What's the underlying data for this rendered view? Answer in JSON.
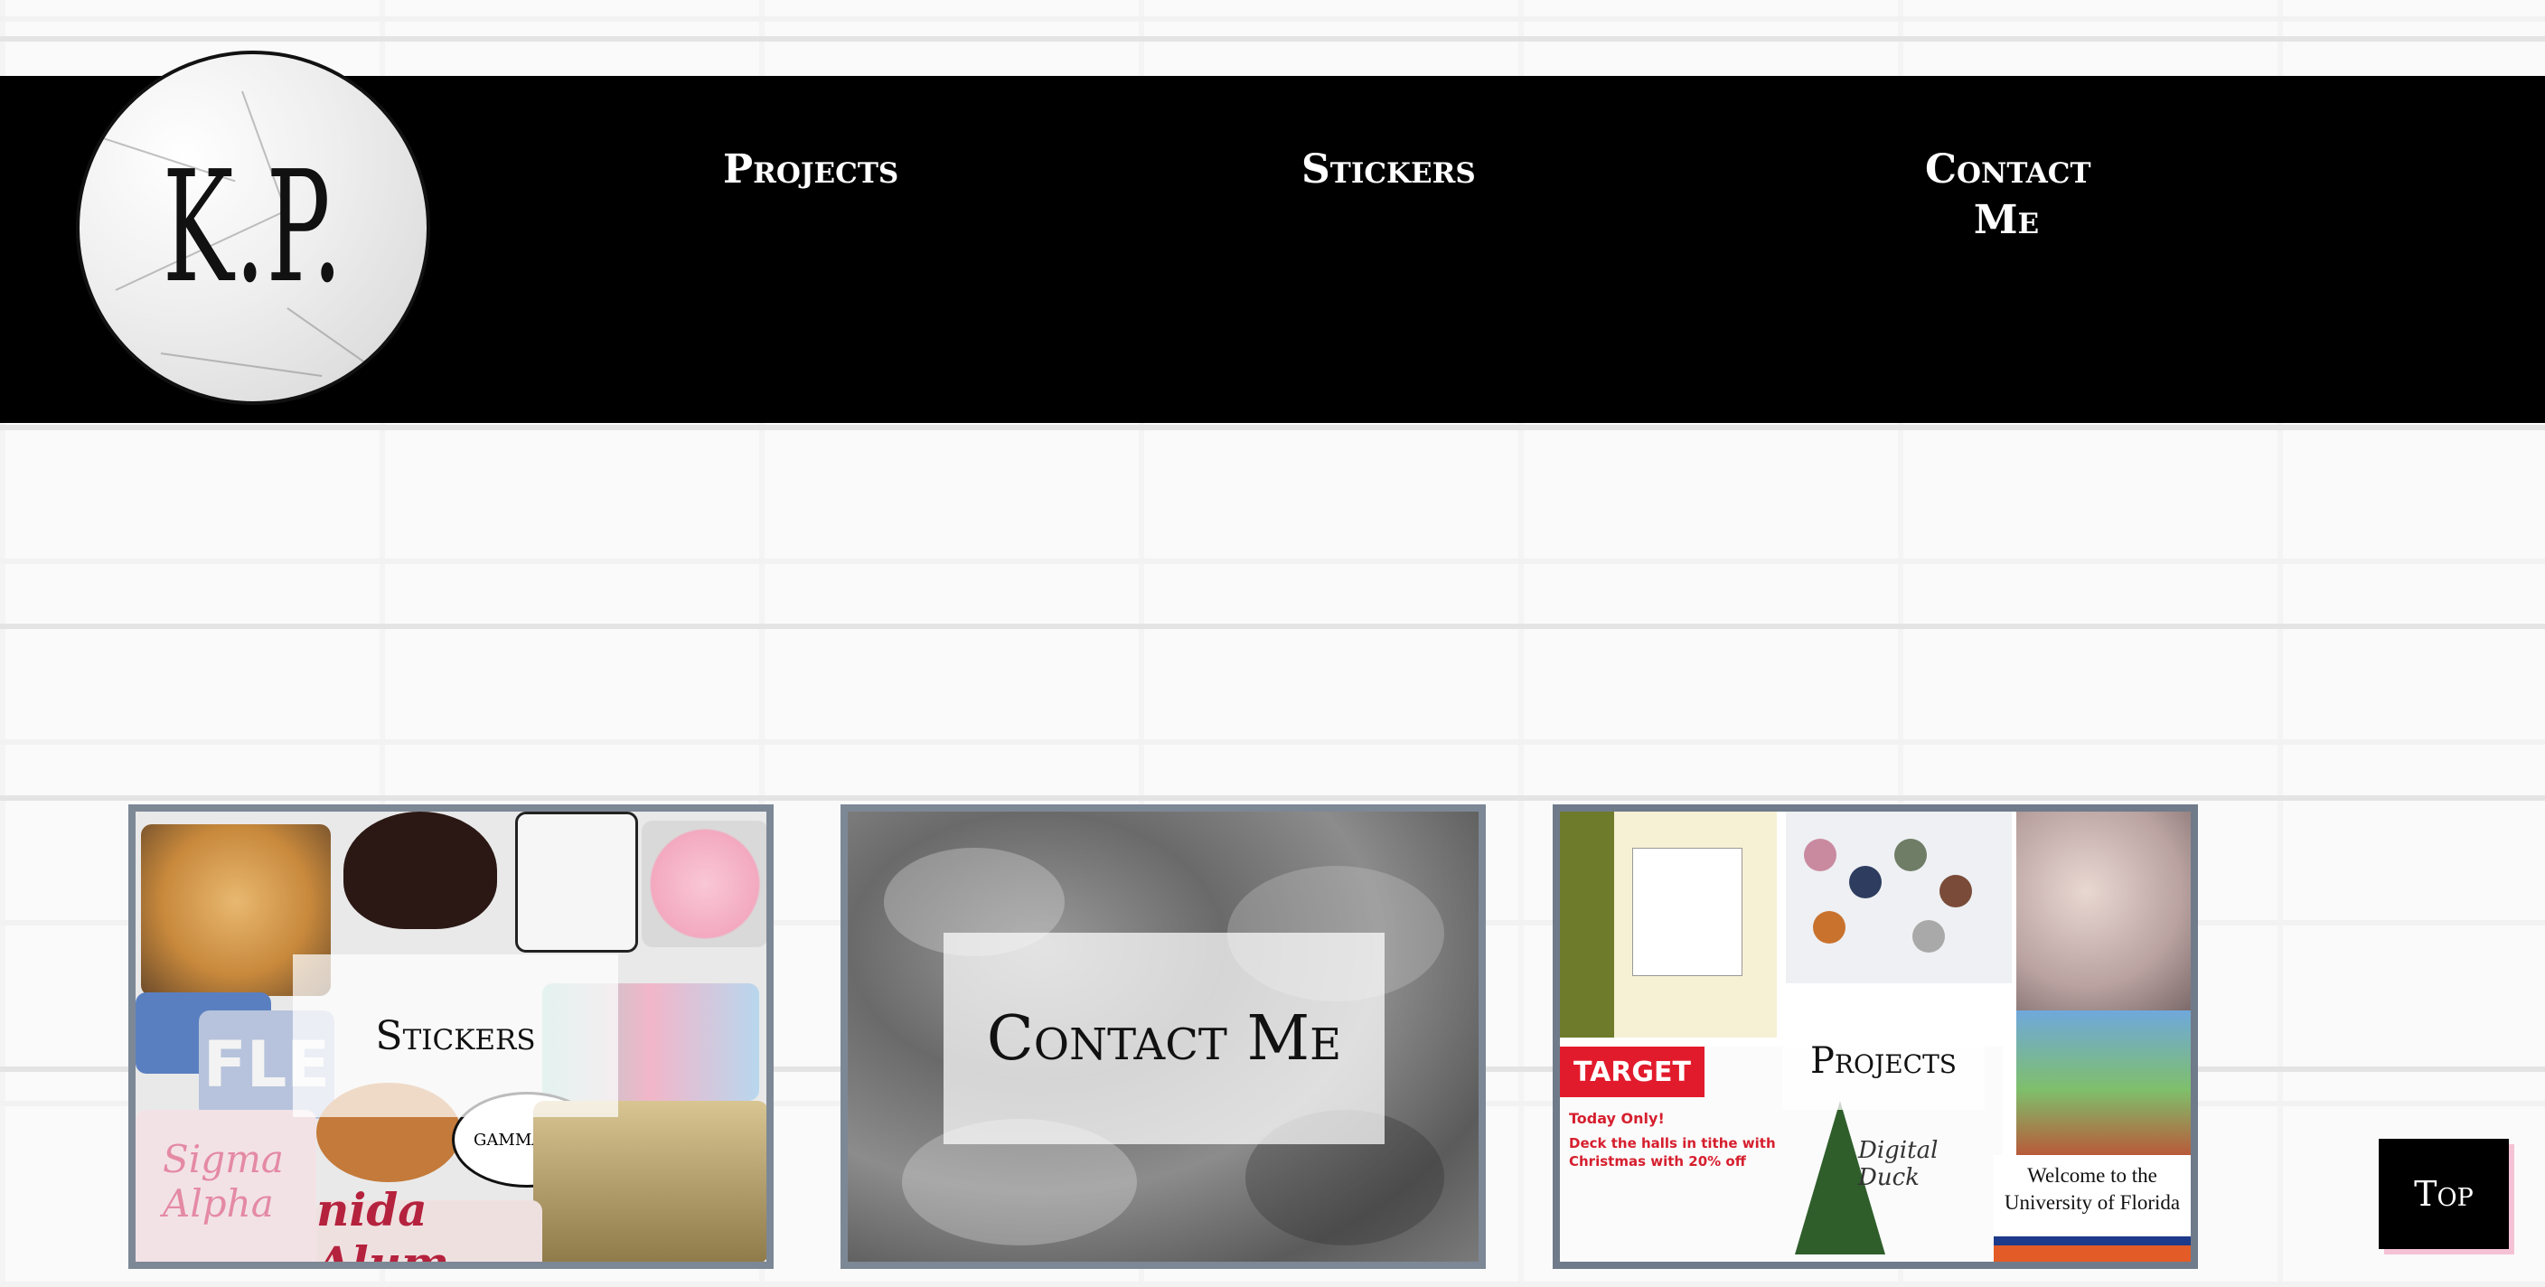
{
  "logo": {
    "text": "K.P."
  },
  "nav": {
    "projects": "Projects",
    "stickers": "Stickers",
    "contact_line1": "Contact",
    "contact_line2": "Me"
  },
  "cards": {
    "stickers": {
      "label": "Stickers"
    },
    "contact": {
      "label": "Contact Me"
    },
    "projects": {
      "label": "Projects",
      "thumb_texts": {
        "target": "TARGET",
        "today_only": "Today Only!",
        "deck": "Deck the halls in tithe with",
        "christmas": "Christmas with 20% off",
        "welcome_line1": "Welcome to the",
        "welcome_line2": "University of Florida",
        "digital_duck": "Digital Duck"
      }
    }
  },
  "sticker_texts": {
    "flea": "FLE",
    "sigma": "Sigma",
    "alpha": "Alpha",
    "florida": "nida Alum",
    "gamma": "GAMMA PHI"
  },
  "top_button": {
    "label": "Top"
  },
  "colors": {
    "header_bg": "#000000",
    "card_border": "#7d8896",
    "top_shadow": "#f4c2d4"
  }
}
